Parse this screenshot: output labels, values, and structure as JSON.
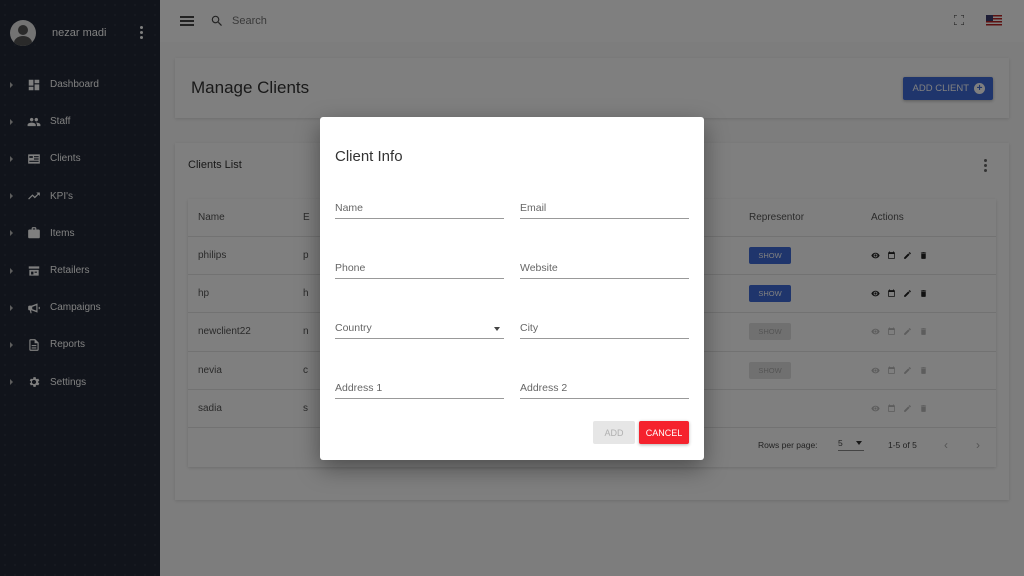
{
  "user": {
    "name": "nezar madi"
  },
  "sidebar": {
    "items": [
      {
        "label": "Dashboard",
        "icon": "dashboard-icon"
      },
      {
        "label": "Staff",
        "icon": "staff-icon"
      },
      {
        "label": "Clients",
        "icon": "clients-icon"
      },
      {
        "label": "KPI's",
        "icon": "trend-icon"
      },
      {
        "label": "Items",
        "icon": "briefcase-icon"
      },
      {
        "label": "Retailers",
        "icon": "store-icon"
      },
      {
        "label": "Campaigns",
        "icon": "megaphone-icon"
      },
      {
        "label": "Reports",
        "icon": "reports-icon"
      },
      {
        "label": "Settings",
        "icon": "gear-icon"
      }
    ]
  },
  "topbar": {
    "search_placeholder": "Search"
  },
  "page": {
    "title": "Manage Clients",
    "add_client_label": "ADD CLIENT"
  },
  "list": {
    "title": "Clients List",
    "columns": {
      "name": "Name",
      "col2": "E",
      "representor": "Representor",
      "actions": "Actions"
    },
    "rows": [
      {
        "name": "philips",
        "col2": "p",
        "show": "SHOW",
        "enabled": true
      },
      {
        "name": "hp",
        "col2": "h",
        "show": "SHOW",
        "enabled": true
      },
      {
        "name": "newclient22",
        "col2": "n",
        "show": "SHOW",
        "enabled": false
      },
      {
        "name": "nevia",
        "col2": "c",
        "show": "SHOW",
        "enabled": false
      },
      {
        "name": "sadia",
        "col2": "s",
        "show": "",
        "enabled": false
      }
    ],
    "footer": {
      "rows_per_page_label": "Rows per page:",
      "rows_per_page": "5",
      "range": "1-5 of 5"
    }
  },
  "dialog": {
    "title": "Client Info",
    "fields": {
      "name": "Name",
      "email": "Email",
      "phone": "Phone",
      "website": "Website",
      "country": "Country",
      "city": "City",
      "address1": "Address 1",
      "address2": "Address 2"
    },
    "add_label": "ADD",
    "cancel_label": "CANCEL"
  },
  "colors": {
    "primary": "#3f6ad8",
    "danger": "#f5222d",
    "sidebar": "#222936"
  }
}
